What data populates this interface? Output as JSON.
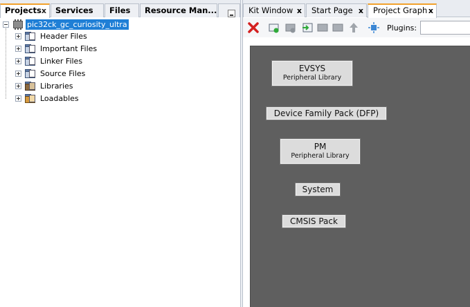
{
  "left_panel": {
    "tabs": [
      {
        "label": "Projects",
        "close": "x",
        "active": true
      },
      {
        "label": "Services",
        "close": "",
        "active": false
      },
      {
        "label": "Files",
        "close": "",
        "active": false
      },
      {
        "label": "Resource Man...",
        "close": "",
        "active": false
      }
    ],
    "tree": {
      "root_label": "pic32ck_gc_curiosity_ultra",
      "items": [
        {
          "label": "Header Files",
          "icon": "folder-icon"
        },
        {
          "label": "Important Files",
          "icon": "folder-icon"
        },
        {
          "label": "Linker Files",
          "icon": "folder-icon"
        },
        {
          "label": "Source Files",
          "icon": "folder-icon"
        },
        {
          "label": "Libraries",
          "icon": "library-folder-icon"
        },
        {
          "label": "Loadables",
          "icon": "loadables-folder-icon"
        }
      ]
    }
  },
  "right_panel": {
    "tabs": [
      {
        "label": "Kit Window",
        "close": "x",
        "active": false
      },
      {
        "label": "Start Page",
        "close": "x",
        "active": false
      },
      {
        "label": "Project Graph",
        "close": "x",
        "active": true
      }
    ],
    "toolbar": {
      "plugins_label": "Plugins:",
      "plugins_value": ""
    },
    "graph_nodes": [
      {
        "title": "EVSYS",
        "subtitle": "Peripheral Library"
      },
      {
        "title": "Device Family Pack (DFP)",
        "subtitle": ""
      },
      {
        "title": "PM",
        "subtitle": "Peripheral Library"
      },
      {
        "title": "System",
        "subtitle": ""
      },
      {
        "title": "CMSIS Pack",
        "subtitle": ""
      }
    ]
  },
  "colors": {
    "selection": "#1f7fd6",
    "active_tab_accent": "#f1a12b",
    "graph_background": "#5f5f5f",
    "node_fill": "#dcdcdc",
    "delete_red": "#d42020"
  }
}
